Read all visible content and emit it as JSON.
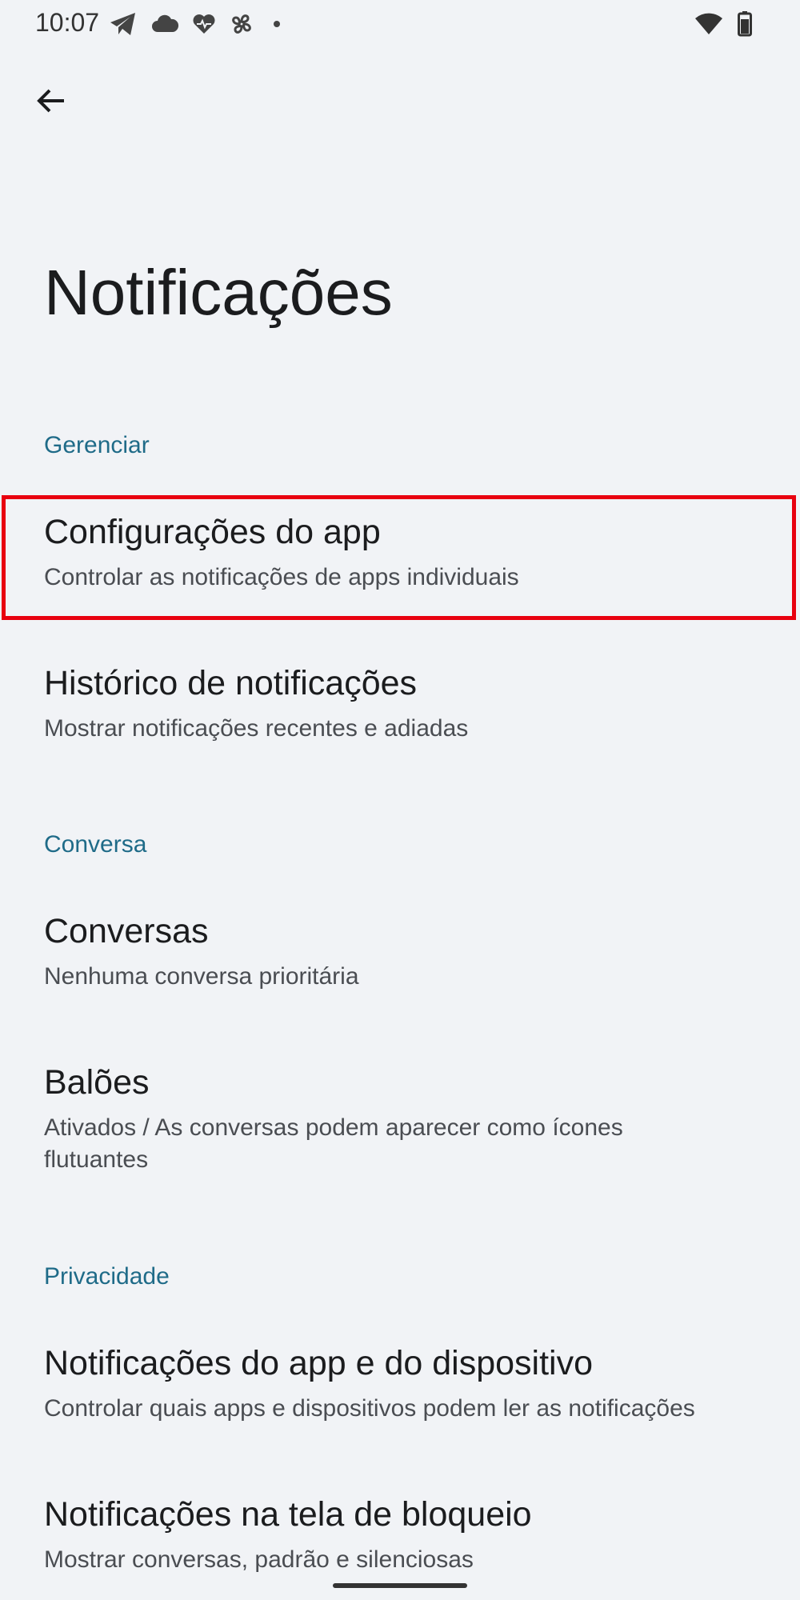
{
  "status_bar": {
    "time": "10:07",
    "left_icons": [
      "telegram-icon",
      "cloud-icon",
      "heart-monitor-icon",
      "pinwheel-icon",
      "dot-icon"
    ],
    "right_icons": [
      "wifi-icon",
      "battery-icon"
    ]
  },
  "header": {
    "back_icon": "arrow-back-icon",
    "title": "Notificações"
  },
  "sections": {
    "manage": {
      "label": "Gerenciar",
      "items": [
        {
          "title": "Configurações do app",
          "summary": "Controlar as notificações de apps individuais"
        },
        {
          "title": "Histórico de notificações",
          "summary": "Mostrar notificações recentes e adiadas"
        }
      ]
    },
    "conversation": {
      "label": "Conversa",
      "items": [
        {
          "title": "Conversas",
          "summary": "Nenhuma conversa prioritária"
        },
        {
          "title": "Balões",
          "summary": "Ativados / As conversas podem aparecer como ícones flutuantes"
        }
      ]
    },
    "privacy": {
      "label": "Privacidade",
      "items": [
        {
          "title": "Notificações do app e do dispositivo",
          "summary": "Controlar quais apps e dispositivos podem ler as notificações"
        },
        {
          "title": "Notificações na tela de bloqueio",
          "summary": "Mostrar conversas, padrão e silenciosas"
        }
      ]
    }
  },
  "colors": {
    "background": "#f1f3f6",
    "section_header": "#1f6b88",
    "highlight": "#e8000f"
  }
}
